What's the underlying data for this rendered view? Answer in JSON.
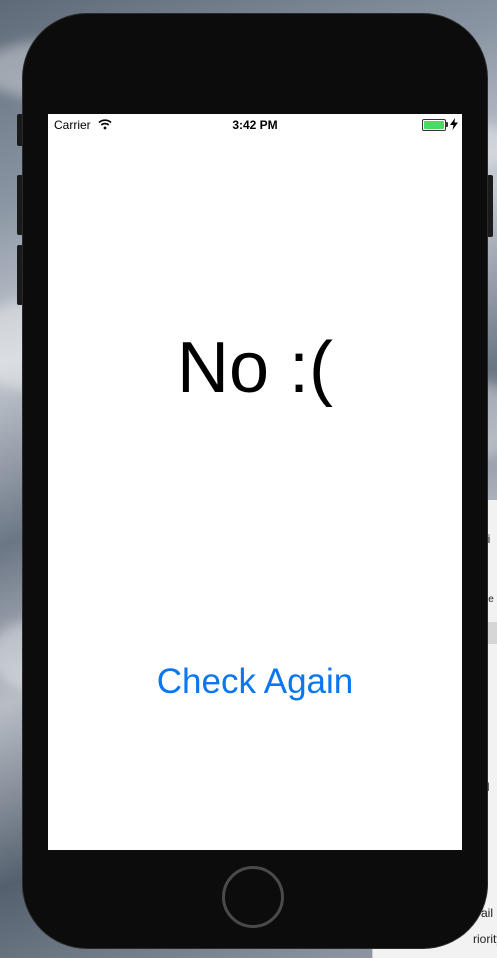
{
  "status_bar": {
    "carrier": "Carrier",
    "time": "3:42 PM",
    "battery_level": 1.0,
    "wifi_icon": "wifi-icon",
    "charging_icon": "bolt-icon"
  },
  "main": {
    "result_text": "No :(",
    "check_button_label": "Check Again"
  },
  "colors": {
    "accent": "#0a76f0",
    "battery": "#4cd964",
    "device": "#0c0c0c",
    "screen": "#ffffff"
  },
  "background_window": {
    "rows": [
      "ni",
      "De",
      "H",
      "e",
      "ail",
      "riority"
    ]
  }
}
